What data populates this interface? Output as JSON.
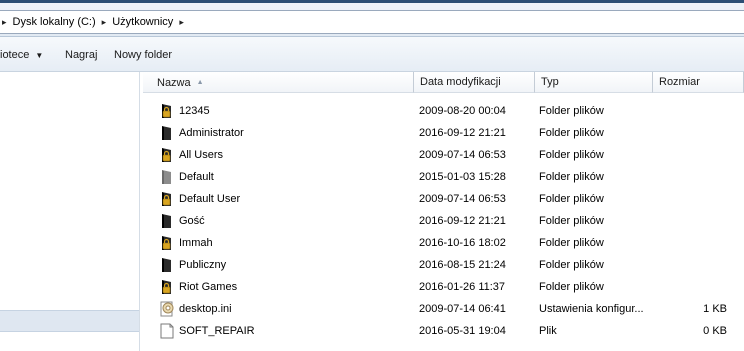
{
  "breadcrumb": {
    "items": [
      "Dysk lokalny (C:)",
      "Użytkownicy"
    ]
  },
  "toolbar": {
    "library_label": "iotece",
    "burn_label": "Nagraj",
    "new_folder_label": "Nowy folder"
  },
  "columns": {
    "name": "Nazwa",
    "date": "Data modyfikacji",
    "type": "Typ",
    "size": "Rozmiar"
  },
  "files": [
    {
      "name": "12345",
      "date": "2009-08-20 00:04",
      "type": "Folder plików",
      "size": "",
      "icon": "locked-folder-icon"
    },
    {
      "name": "Administrator",
      "date": "2016-09-12 21:21",
      "type": "Folder plików",
      "size": "",
      "icon": "dark-folder-icon"
    },
    {
      "name": "All Users",
      "date": "2009-07-14 06:53",
      "type": "Folder plików",
      "size": "",
      "icon": "locked-folder-icon"
    },
    {
      "name": "Default",
      "date": "2015-01-03 15:28",
      "type": "Folder plików",
      "size": "",
      "icon": "hidden-folder-icon"
    },
    {
      "name": "Default User",
      "date": "2009-07-14 06:53",
      "type": "Folder plików",
      "size": "",
      "icon": "locked-folder-icon"
    },
    {
      "name": "Gość",
      "date": "2016-09-12 21:21",
      "type": "Folder plików",
      "size": "",
      "icon": "dark-folder-icon"
    },
    {
      "name": "Immah",
      "date": "2016-10-16 18:02",
      "type": "Folder plików",
      "size": "",
      "icon": "locked-folder-icon"
    },
    {
      "name": "Publiczny",
      "date": "2016-08-15 21:24",
      "type": "Folder plików",
      "size": "",
      "icon": "dark-folder-icon"
    },
    {
      "name": "Riot Games",
      "date": "2016-01-26 11:37",
      "type": "Folder plików",
      "size": "",
      "icon": "locked-folder-icon"
    },
    {
      "name": "desktop.ini",
      "date": "2009-07-14 06:41",
      "type": "Ustawienia konfigur...",
      "size": "1 KB",
      "icon": "settings-file-icon"
    },
    {
      "name": "SOFT_REPAIR",
      "date": "2016-05-31 19:04",
      "type": "Plik",
      "size": "0 KB",
      "icon": "blank-file-icon"
    }
  ],
  "colors": {
    "header_bg": "#e6edf5",
    "folder_dark": "#2a2a2a",
    "lock": "#d9a520"
  }
}
